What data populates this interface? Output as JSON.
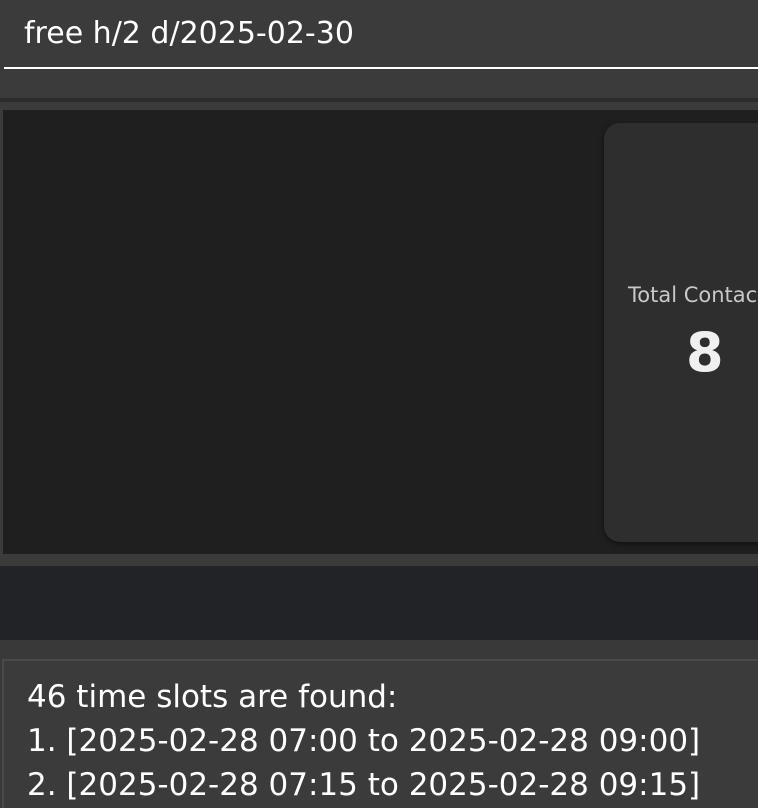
{
  "command": {
    "value": "free h/2 d/2025-02-30"
  },
  "stats": {
    "total_contacts_label": "Total Contac",
    "total_contacts_value": "8"
  },
  "result": {
    "lines": [
      "46 time slots are found:",
      "1. [2025-02-28 07:00 to 2025-02-28 09:00]",
      "2. [2025-02-28 07:15 to 2025-02-28 09:15]"
    ]
  }
}
